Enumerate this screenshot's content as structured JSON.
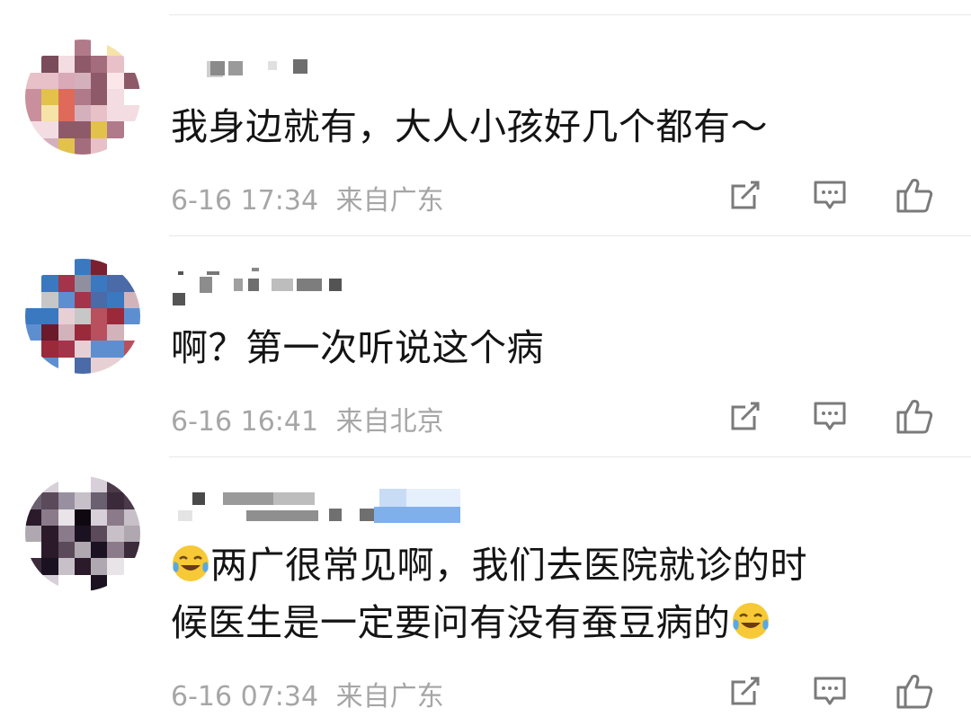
{
  "comments": [
    {
      "text": "我身边就有，大人小孩好几个都有～",
      "date": "6-16 17:34",
      "location": "来自广东"
    },
    {
      "text": "啊？第一次听说这个病",
      "date": "6-16 16:41",
      "location": "来自北京"
    },
    {
      "line1": "两广很常见啊，我们去医院就诊的时",
      "line2": "候医生是一定要问有没有蚕豆病的",
      "date": "6-16 07:34",
      "location": "来自广东",
      "emoji": "laughing-crying-emoji"
    }
  ],
  "actions": {
    "repost": "repost-icon",
    "comment": "comment-icon",
    "like": "thumbs-up-icon"
  },
  "colors": {
    "text": "#141414",
    "meta": "#a6a6a6",
    "icon": "#7a7a7a",
    "divider": "#e8e8e8"
  }
}
